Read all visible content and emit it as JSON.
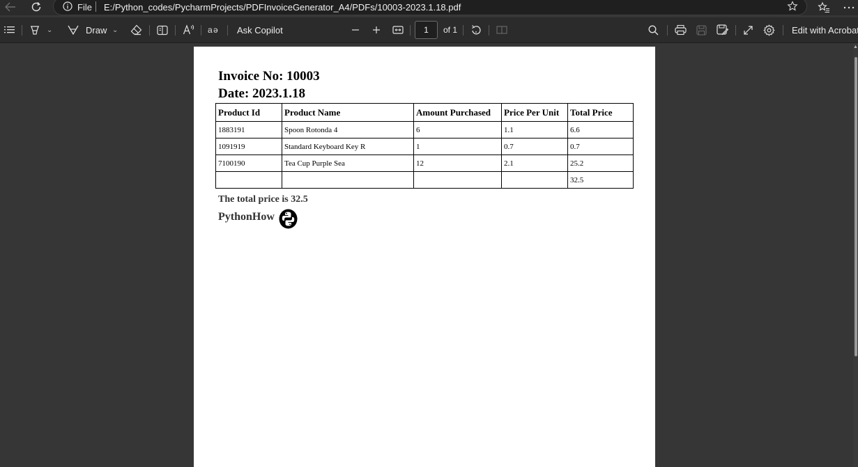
{
  "browser": {
    "url_scheme_label": "File",
    "url": "E:/Python_codes/PycharmProjects/PDFInvoiceGenerator_A4/PDFs/10003-2023.1.18.pdf"
  },
  "toolbar": {
    "draw_label": "Draw",
    "ask_copilot_label": "Ask Copilot",
    "current_page": "1",
    "page_count_label": "of 1",
    "edit_with_acrobat_label": "Edit with Acrobat"
  },
  "document": {
    "invoice_title": "Invoice No: 10003",
    "date_line": "Date: 2023.1.18",
    "table": {
      "headers": [
        "Product Id",
        "Product Name",
        "Amount Purchased",
        "Price Per Unit",
        "Total Price"
      ],
      "rows": [
        [
          "1883191",
          "Spoon Rotonda 4",
          "6",
          "1.1",
          "6.6"
        ],
        [
          "1091919",
          "Standard Keyboard Key R",
          "1",
          "0.7",
          "0.7"
        ],
        [
          "7100190",
          "Tea Cup Purple Sea",
          "12",
          "2.1",
          "25.2"
        ],
        [
          "",
          "",
          "",
          "",
          "32.5"
        ]
      ]
    },
    "total_sentence": "The total price is 32.5",
    "company_name": "PythonHow"
  },
  "icons": {
    "back": "back-arrow-icon",
    "refresh": "refresh-icon",
    "info": "info-icon",
    "favorite": "star-icon",
    "favorites": "favorites-icon",
    "more": "more-icon",
    "contents": "table-of-contents-icon",
    "highlight": "highlighter-icon",
    "draw": "draw-icon",
    "erase": "eraser-icon",
    "page_view": "page-view-icon",
    "read_aloud": "read-aloud-icon",
    "translate": "translate-icon",
    "zoom_out": "minus-icon",
    "zoom_in": "plus-icon",
    "fit": "fit-width-icon",
    "rotate": "rotate-icon",
    "two_page": "two-page-icon",
    "search": "search-icon",
    "print": "print-icon",
    "save": "save-icon",
    "save_as": "save-as-icon",
    "fullscreen": "expand-icon",
    "settings": "gear-icon",
    "logo": "python-logo"
  }
}
